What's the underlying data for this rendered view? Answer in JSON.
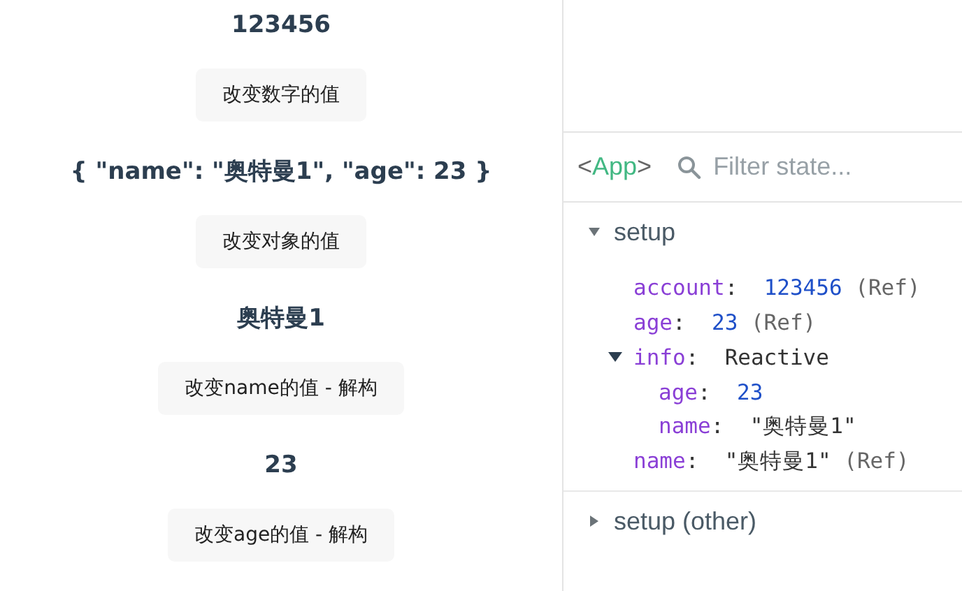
{
  "demo": [
    {
      "kind": "value",
      "text": "123456"
    },
    {
      "kind": "button",
      "text": "改变数字的值"
    },
    {
      "kind": "value",
      "text": "{ \"name\": \"奥特曼1\", \"age\": 23 }"
    },
    {
      "kind": "button",
      "text": "改变对象的值"
    },
    {
      "kind": "value",
      "text": "奥特曼1"
    },
    {
      "kind": "button",
      "text": "改变name的值 - 解构"
    },
    {
      "kind": "value",
      "text": "23"
    },
    {
      "kind": "button",
      "text": "改变age的值 - 解构"
    }
  ],
  "devtools": {
    "component": {
      "open": "<",
      "name": "App",
      "close": ">"
    },
    "filter": {
      "placeholder": "Filter state..."
    },
    "sections": [
      {
        "title": "setup",
        "expanded": true,
        "fields": [
          {
            "key": "account",
            "sep": ":",
            "value": "123456",
            "kind": "number",
            "suffix": "(Ref)"
          },
          {
            "key": "age",
            "sep": ":",
            "value": "23",
            "kind": "number",
            "suffix": "(Ref)"
          },
          {
            "key": "info",
            "sep": ":",
            "value": "Reactive",
            "kind": "type",
            "expanded": true,
            "children": [
              {
                "key": "age",
                "sep": ":",
                "value": "23",
                "kind": "number"
              },
              {
                "key": "name",
                "sep": ":",
                "value": "\"奥特曼1\"",
                "kind": "string"
              }
            ]
          },
          {
            "key": "name",
            "sep": ":",
            "value": "\"奥特曼1\"",
            "kind": "string",
            "suffix": "(Ref)"
          }
        ]
      },
      {
        "title": "setup (other)",
        "expanded": false
      }
    ]
  }
}
